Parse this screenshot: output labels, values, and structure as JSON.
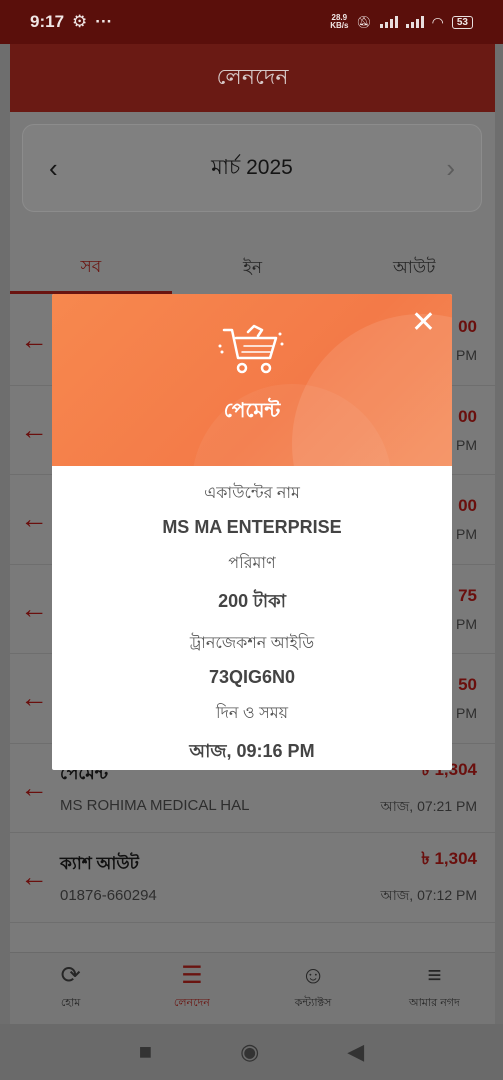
{
  "status_bar": {
    "time": "9:17",
    "dots": "···",
    "speed_value": "28.9",
    "speed_unit": "KB/s",
    "battery": "53"
  },
  "app": {
    "title": "লেনদেন",
    "month": "মার্চ 2025",
    "tabs": [
      {
        "label": "সব",
        "active": true
      },
      {
        "label": "ইন",
        "active": false
      },
      {
        "label": "আউট",
        "active": false
      }
    ],
    "transactions": [
      {
        "title": "",
        "sub": "",
        "amount": "00",
        "time": "PM"
      },
      {
        "title": "",
        "sub": "",
        "amount": "00",
        "time": "PM"
      },
      {
        "title": "",
        "sub": "",
        "amount": "00",
        "time": "PM"
      },
      {
        "title": "",
        "sub": "",
        "amount": "75",
        "time": "PM"
      },
      {
        "title": "",
        "sub": "",
        "amount": "50",
        "time": "PM"
      },
      {
        "title": "পেমেন্ট",
        "sub": "MS ROHIMA MEDICAL HAL",
        "amount": "৳ 1,304",
        "time": "আজ, 07:21 PM"
      },
      {
        "title": "ক্যাশ আউট",
        "sub": "01876-660294",
        "amount": "৳ 1,304",
        "time": "আজ, 07:12 PM"
      }
    ],
    "bottom_nav": [
      {
        "label": "হোম",
        "icon": "home-icon",
        "glyph": "⟳",
        "active": false
      },
      {
        "label": "লেনদেন",
        "icon": "transactions-icon",
        "glyph": "☰",
        "active": true
      },
      {
        "label": "কন্ট্যাক্টস",
        "icon": "contacts-icon",
        "glyph": "☺",
        "active": false
      },
      {
        "label": "আমার নগদ",
        "icon": "menu-icon",
        "glyph": "≡",
        "active": false
      }
    ]
  },
  "modal": {
    "title": "পেমেন্ট",
    "account_label": "একাউন্টের নাম",
    "account_value": "MS MA ENTERPRISE",
    "amount_label": "পরিমাণ",
    "amount_value": "200 টাকা",
    "txid_label": "ট্রানজেকশন আইডি",
    "txid_value": "73QIG6N0",
    "datetime_label": "দিন ও সময়",
    "datetime_value": "আজ, 09:16 PM"
  },
  "colors": {
    "accent": "#f37a48",
    "brand_dark": "#6a1410"
  }
}
